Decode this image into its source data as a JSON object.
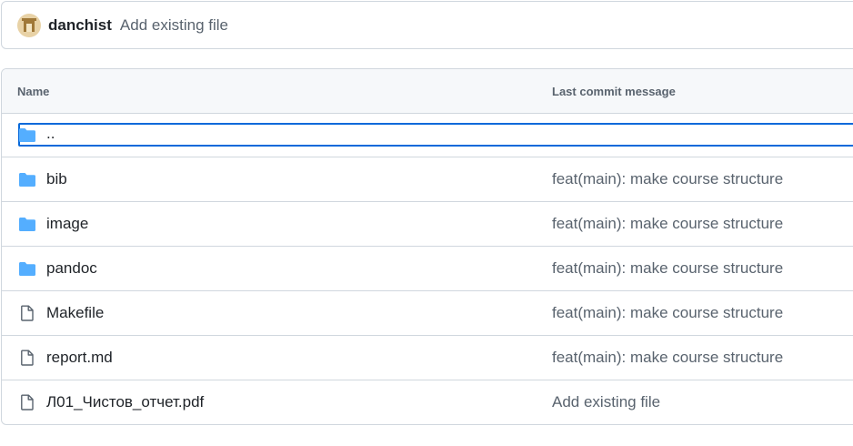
{
  "commit_header": {
    "author": "danchist",
    "message": "Add existing file"
  },
  "table": {
    "headers": {
      "name": "Name",
      "last_commit": "Last commit message"
    },
    "parent_row": {
      "name": "..",
      "icon": "folder-icon"
    },
    "rows": [
      {
        "name": "bib",
        "type": "folder",
        "icon": "folder-icon",
        "message": "feat(main): make course structure"
      },
      {
        "name": "image",
        "type": "folder",
        "icon": "folder-icon",
        "message": "feat(main): make course structure"
      },
      {
        "name": "pandoc",
        "type": "folder",
        "icon": "folder-icon",
        "message": "feat(main): make course structure"
      },
      {
        "name": "Makefile",
        "type": "file",
        "icon": "file-icon",
        "message": "feat(main): make course structure"
      },
      {
        "name": "report.md",
        "type": "file",
        "icon": "file-icon",
        "message": "feat(main): make course structure"
      },
      {
        "name": "Л01_Чистов_отчет.pdf",
        "type": "file",
        "icon": "file-icon",
        "message": "Add existing file"
      }
    ]
  },
  "colors": {
    "folder": "#54aeff",
    "file_icon": "#59636e",
    "focus": "#0969da",
    "border": "#d0d7de",
    "header_bg": "#f6f8fa"
  }
}
